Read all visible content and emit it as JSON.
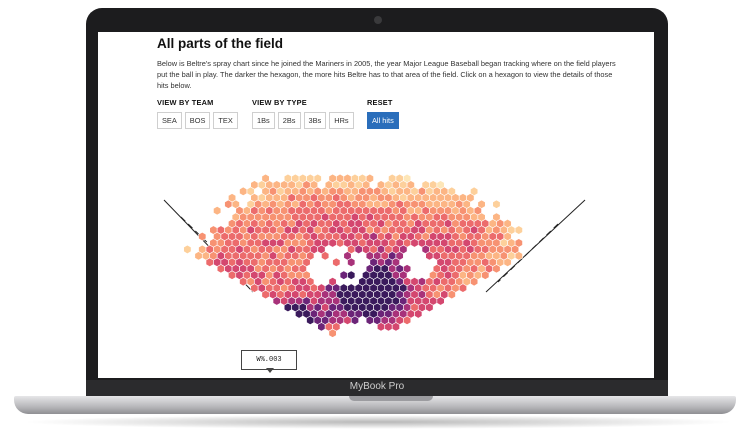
{
  "device": {
    "brand_label": "MyBook Pro"
  },
  "article": {
    "title": "All parts of the field",
    "intro": "Below is Beltre's spray chart since he joined the Mariners in 2005, the year Major League Baseball began tracking where on the field players put the ball in play. The darker the hexagon, the more hits Beltre has to that area of the field. Click on a hexagon to view the details of those hits below."
  },
  "filters": {
    "team": {
      "label": "VIEW BY TEAM",
      "options": [
        "SEA",
        "BOS",
        "TEX"
      ]
    },
    "type": {
      "label": "VIEW BY TYPE",
      "options": [
        "1Bs",
        "2Bs",
        "3Bs",
        "HRs"
      ]
    },
    "reset": {
      "label": "RESET",
      "button": "All hits"
    }
  },
  "tooltip": {
    "text": "W%.003"
  },
  "colors": {
    "scale": [
      "#fde6b8",
      "#fdd09b",
      "#fcb584",
      "#f79272",
      "#ec6b6c",
      "#d4476f",
      "#a8327a",
      "#6b2478",
      "#3a1a5c"
    ],
    "accent": "#2a6ebb"
  }
}
